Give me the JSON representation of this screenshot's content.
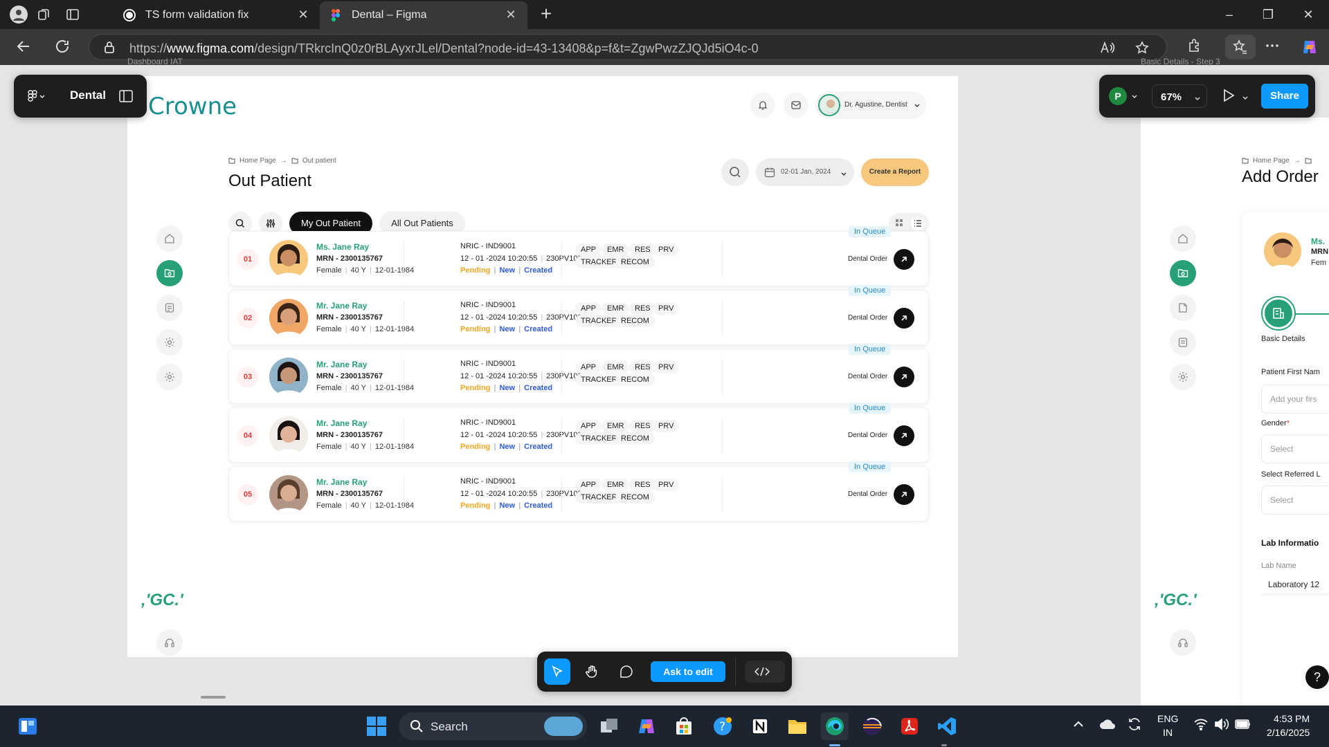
{
  "browser": {
    "tabs": [
      {
        "title": "TS form validation fix",
        "close": "✕"
      },
      {
        "title": "Dental – Figma",
        "close": "✕"
      }
    ],
    "new_tab": "+",
    "url_prefix": "https://",
    "url_host": "www.figma.com",
    "url_path": "/design/TRkrcInQ0z0rBLAyxrJLel/Dental?node-id=43-13408&p=f&t=ZgwPwzZJQJd5iO4c-0",
    "window_controls": [
      "–",
      "❐",
      "✕"
    ]
  },
  "figma": {
    "file_name": "Dental",
    "hint_left": "Dashboard IAT",
    "hint_right": "Basic Details - Step 3",
    "avatar_letter": "P",
    "zoom": "67%",
    "share_label": "Share",
    "ask_to_edit": "Ask to edit",
    "help": "?"
  },
  "app": {
    "logo": "Crowne",
    "user_name": "Dr. Agustine, Dentist",
    "breadcrumb": {
      "home": "Home Page",
      "current": "Out patient"
    },
    "page_title": "Out Patient",
    "date_range": "02-01 Jan, 2024",
    "create_report": "Create a Report",
    "tabs": [
      "My Out Patient",
      "All Out Patients"
    ],
    "brand_mark": "‚'GC.'",
    "status_colors": {
      "accent": "#27a07a",
      "pending": "#f5a623",
      "link": "#2e5bd8",
      "queue": "#2a8cc7",
      "report": "#f7c77e"
    }
  },
  "patients": [
    {
      "num": "01",
      "name": "Ms. Jane Ray",
      "mrn": "MRN - 2300135767",
      "gender": "Female",
      "age": "40 Y",
      "dob": "12-01-1984",
      "nric": "NRIC - IND9001",
      "datetime": "12 - 01 -2024 10:20:55",
      "code": "230PV100005",
      "status": [
        "Pending",
        "New",
        "Created"
      ],
      "chips": [
        "APP",
        "EMR",
        "RES",
        "PRV",
        "TRACKER",
        "RECOM"
      ],
      "queue": "In Queue",
      "order": "Dental Order"
    },
    {
      "num": "02",
      "name": "Mr. Jane Ray",
      "mrn": "MRN - 2300135767",
      "gender": "Female",
      "age": "40 Y",
      "dob": "12-01-1984",
      "nric": "NRIC - IND9001",
      "datetime": "12 - 01 -2024 10:20:55",
      "code": "230PV100005",
      "status": [
        "Pending",
        "New",
        "Created"
      ],
      "chips": [
        "APP",
        "EMR",
        "RES",
        "PRV",
        "TRACKER",
        "RECOM"
      ],
      "queue": "In Queue",
      "order": "Dental Order"
    },
    {
      "num": "03",
      "name": "Mr. Jane Ray",
      "mrn": "MRN - 2300135767",
      "gender": "Female",
      "age": "40 Y",
      "dob": "12-01-1984",
      "nric": "NRIC - IND9001",
      "datetime": "12 - 01 -2024 10:20:55",
      "code": "230PV100005",
      "status": [
        "Pending",
        "New",
        "Created"
      ],
      "chips": [
        "APP",
        "EMR",
        "RES",
        "PRV",
        "TRACKER",
        "RECOM"
      ],
      "queue": "In Queue",
      "order": "Dental Order"
    },
    {
      "num": "04",
      "name": "Mr. Jane Ray",
      "mrn": "MRN - 2300135767",
      "gender": "Female",
      "age": "40 Y",
      "dob": "12-01-1984",
      "nric": "NRIC - IND9001",
      "datetime": "12 - 01 -2024 10:20:55",
      "code": "230PV100005",
      "status": [
        "Pending",
        "New",
        "Created"
      ],
      "chips": [
        "APP",
        "EMR",
        "RES",
        "PRV",
        "TRACKER",
        "RECOM"
      ],
      "queue": "In Queue",
      "order": "Dental Order"
    },
    {
      "num": "05",
      "name": "Mr. Jane Ray",
      "mrn": "MRN - 2300135767",
      "gender": "Female",
      "age": "40 Y",
      "dob": "12-01-1984",
      "nric": "NRIC - IND9001",
      "datetime": "12 - 01 -2024 10:20:55",
      "code": "230PV100005",
      "status": [
        "Pending",
        "New",
        "Created"
      ],
      "chips": [
        "APP",
        "EMR",
        "RES",
        "PRV",
        "TRACKER",
        "RECOM"
      ],
      "queue": "In Queue",
      "order": "Dental Order"
    }
  ],
  "add_order": {
    "breadcrumb_home": "Home Page",
    "title": "Add Order",
    "patient_prefix": "Ms.",
    "patient_mrn": "MRN",
    "patient_gender": "Fem",
    "step_label": "Basic Details",
    "first_name_label": "Patient First Nam",
    "first_name_placeholder": "Add your firs",
    "gender_label": "Gender",
    "gender_required": "*",
    "gender_placeholder": "Select",
    "referred_label": "Select Referred L",
    "referred_placeholder": "Select",
    "lab_section": "Lab Informatio",
    "lab_name_label": "Lab Name",
    "lab_name_value": "Laboratory 12"
  },
  "taskbar": {
    "search_placeholder": "Search",
    "lang_top": "ENG",
    "lang_bottom": "IN",
    "time": "4:53 PM",
    "date": "2/16/2025"
  }
}
